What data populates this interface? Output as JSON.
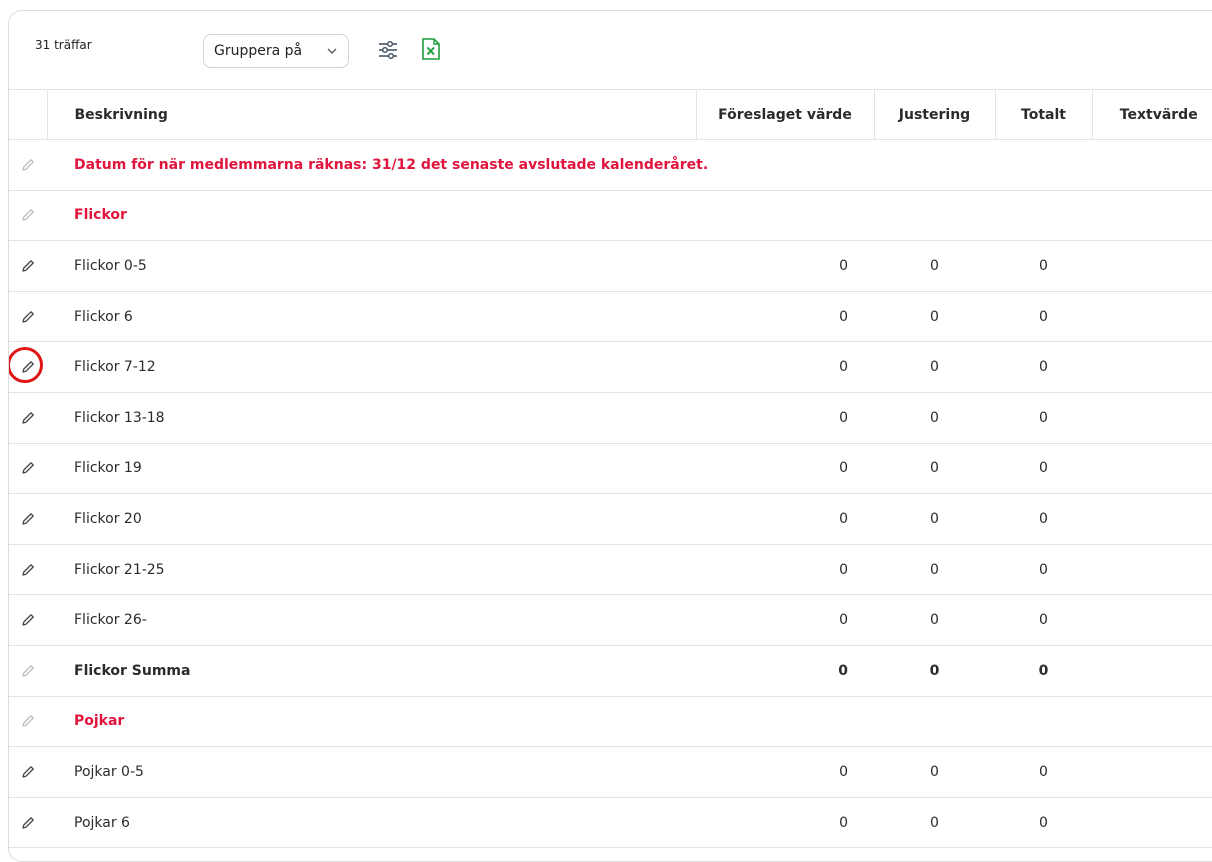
{
  "toolbar": {
    "hits": "31 träffar",
    "group_by_label": "Gruppera på",
    "filter_icon": "sliders-icon",
    "export_icon": "excel-icon"
  },
  "columns": {
    "description": "Beskrivning",
    "suggested": "Föreslaget värde",
    "adjustment": "Justering",
    "total": "Totalt",
    "text_value": "Textvärde"
  },
  "colors": {
    "accent_red": "#e0143c",
    "excel_green": "#1f9d3f",
    "annotation_circle": "#e01515"
  },
  "rows": [
    {
      "desc": "Datum för när medlemmarna räknas: 31/12 det senaste avslutade kalenderåret.",
      "suggested": "",
      "adjustment": "",
      "total": ""
    },
    {
      "desc": "Flickor",
      "suggested": "",
      "adjustment": "",
      "total": ""
    },
    {
      "desc": "Flickor 0-5",
      "suggested": "0",
      "adjustment": "0",
      "total": "0"
    },
    {
      "desc": "Flickor 6",
      "suggested": "0",
      "adjustment": "0",
      "total": "0"
    },
    {
      "desc": "Flickor 7-12",
      "suggested": "0",
      "adjustment": "0",
      "total": "0"
    },
    {
      "desc": "Flickor 13-18",
      "suggested": "0",
      "adjustment": "0",
      "total": "0"
    },
    {
      "desc": "Flickor 19",
      "suggested": "0",
      "adjustment": "0",
      "total": "0"
    },
    {
      "desc": "Flickor 20",
      "suggested": "0",
      "adjustment": "0",
      "total": "0"
    },
    {
      "desc": "Flickor 21-25",
      "suggested": "0",
      "adjustment": "0",
      "total": "0"
    },
    {
      "desc": "Flickor 26-",
      "suggested": "0",
      "adjustment": "0",
      "total": "0"
    },
    {
      "desc": "Flickor Summa",
      "suggested": "0",
      "adjustment": "0",
      "total": "0"
    },
    {
      "desc": "Pojkar",
      "suggested": "",
      "adjustment": "",
      "total": ""
    },
    {
      "desc": "Pojkar 0-5",
      "suggested": "0",
      "adjustment": "0",
      "total": "0"
    },
    {
      "desc": "Pojkar 6",
      "suggested": "0",
      "adjustment": "0",
      "total": "0"
    }
  ]
}
